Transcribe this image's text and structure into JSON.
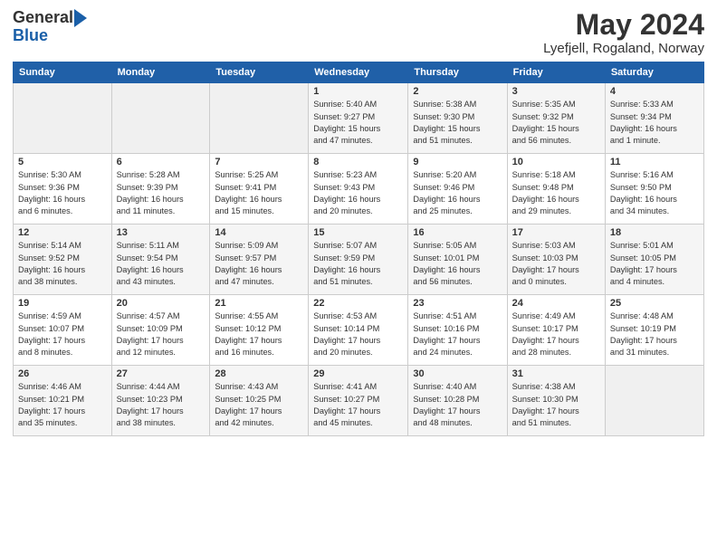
{
  "logo": {
    "line1": "General",
    "line2": "Blue"
  },
  "header": {
    "month_year": "May 2024",
    "location": "Lyefjell, Rogaland, Norway"
  },
  "weekdays": [
    "Sunday",
    "Monday",
    "Tuesday",
    "Wednesday",
    "Thursday",
    "Friday",
    "Saturday"
  ],
  "weeks": [
    [
      {
        "day": "",
        "info": ""
      },
      {
        "day": "",
        "info": ""
      },
      {
        "day": "",
        "info": ""
      },
      {
        "day": "1",
        "info": "Sunrise: 5:40 AM\nSunset: 9:27 PM\nDaylight: 15 hours\nand 47 minutes."
      },
      {
        "day": "2",
        "info": "Sunrise: 5:38 AM\nSunset: 9:30 PM\nDaylight: 15 hours\nand 51 minutes."
      },
      {
        "day": "3",
        "info": "Sunrise: 5:35 AM\nSunset: 9:32 PM\nDaylight: 15 hours\nand 56 minutes."
      },
      {
        "day": "4",
        "info": "Sunrise: 5:33 AM\nSunset: 9:34 PM\nDaylight: 16 hours\nand 1 minute."
      }
    ],
    [
      {
        "day": "5",
        "info": "Sunrise: 5:30 AM\nSunset: 9:36 PM\nDaylight: 16 hours\nand 6 minutes."
      },
      {
        "day": "6",
        "info": "Sunrise: 5:28 AM\nSunset: 9:39 PM\nDaylight: 16 hours\nand 11 minutes."
      },
      {
        "day": "7",
        "info": "Sunrise: 5:25 AM\nSunset: 9:41 PM\nDaylight: 16 hours\nand 15 minutes."
      },
      {
        "day": "8",
        "info": "Sunrise: 5:23 AM\nSunset: 9:43 PM\nDaylight: 16 hours\nand 20 minutes."
      },
      {
        "day": "9",
        "info": "Sunrise: 5:20 AM\nSunset: 9:46 PM\nDaylight: 16 hours\nand 25 minutes."
      },
      {
        "day": "10",
        "info": "Sunrise: 5:18 AM\nSunset: 9:48 PM\nDaylight: 16 hours\nand 29 minutes."
      },
      {
        "day": "11",
        "info": "Sunrise: 5:16 AM\nSunset: 9:50 PM\nDaylight: 16 hours\nand 34 minutes."
      }
    ],
    [
      {
        "day": "12",
        "info": "Sunrise: 5:14 AM\nSunset: 9:52 PM\nDaylight: 16 hours\nand 38 minutes."
      },
      {
        "day": "13",
        "info": "Sunrise: 5:11 AM\nSunset: 9:54 PM\nDaylight: 16 hours\nand 43 minutes."
      },
      {
        "day": "14",
        "info": "Sunrise: 5:09 AM\nSunset: 9:57 PM\nDaylight: 16 hours\nand 47 minutes."
      },
      {
        "day": "15",
        "info": "Sunrise: 5:07 AM\nSunset: 9:59 PM\nDaylight: 16 hours\nand 51 minutes."
      },
      {
        "day": "16",
        "info": "Sunrise: 5:05 AM\nSunset: 10:01 PM\nDaylight: 16 hours\nand 56 minutes."
      },
      {
        "day": "17",
        "info": "Sunrise: 5:03 AM\nSunset: 10:03 PM\nDaylight: 17 hours\nand 0 minutes."
      },
      {
        "day": "18",
        "info": "Sunrise: 5:01 AM\nSunset: 10:05 PM\nDaylight: 17 hours\nand 4 minutes."
      }
    ],
    [
      {
        "day": "19",
        "info": "Sunrise: 4:59 AM\nSunset: 10:07 PM\nDaylight: 17 hours\nand 8 minutes."
      },
      {
        "day": "20",
        "info": "Sunrise: 4:57 AM\nSunset: 10:09 PM\nDaylight: 17 hours\nand 12 minutes."
      },
      {
        "day": "21",
        "info": "Sunrise: 4:55 AM\nSunset: 10:12 PM\nDaylight: 17 hours\nand 16 minutes."
      },
      {
        "day": "22",
        "info": "Sunrise: 4:53 AM\nSunset: 10:14 PM\nDaylight: 17 hours\nand 20 minutes."
      },
      {
        "day": "23",
        "info": "Sunrise: 4:51 AM\nSunset: 10:16 PM\nDaylight: 17 hours\nand 24 minutes."
      },
      {
        "day": "24",
        "info": "Sunrise: 4:49 AM\nSunset: 10:17 PM\nDaylight: 17 hours\nand 28 minutes."
      },
      {
        "day": "25",
        "info": "Sunrise: 4:48 AM\nSunset: 10:19 PM\nDaylight: 17 hours\nand 31 minutes."
      }
    ],
    [
      {
        "day": "26",
        "info": "Sunrise: 4:46 AM\nSunset: 10:21 PM\nDaylight: 17 hours\nand 35 minutes."
      },
      {
        "day": "27",
        "info": "Sunrise: 4:44 AM\nSunset: 10:23 PM\nDaylight: 17 hours\nand 38 minutes."
      },
      {
        "day": "28",
        "info": "Sunrise: 4:43 AM\nSunset: 10:25 PM\nDaylight: 17 hours\nand 42 minutes."
      },
      {
        "day": "29",
        "info": "Sunrise: 4:41 AM\nSunset: 10:27 PM\nDaylight: 17 hours\nand 45 minutes."
      },
      {
        "day": "30",
        "info": "Sunrise: 4:40 AM\nSunset: 10:28 PM\nDaylight: 17 hours\nand 48 minutes."
      },
      {
        "day": "31",
        "info": "Sunrise: 4:38 AM\nSunset: 10:30 PM\nDaylight: 17 hours\nand 51 minutes."
      },
      {
        "day": "",
        "info": ""
      }
    ]
  ]
}
